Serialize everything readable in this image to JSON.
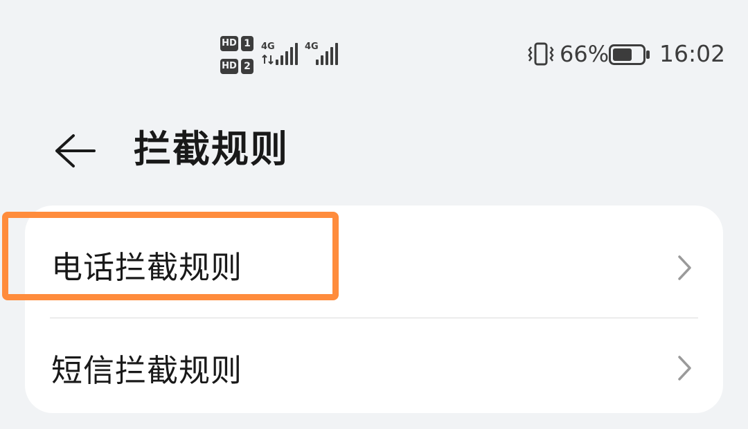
{
  "statusbar": {
    "sim1": {
      "hd": "HD",
      "slot": "1",
      "network": "4G"
    },
    "sim2": {
      "hd": "HD",
      "slot": "2",
      "network": "4G"
    },
    "vibrate_icon": "vibrate-icon",
    "battery_percent": "66%",
    "battery_level": 0.66,
    "time": "16:02"
  },
  "header": {
    "back_icon": "back-arrow-icon",
    "title": "拦截规则"
  },
  "list": {
    "items": [
      {
        "label": "电话拦截规则",
        "icon": "chevron-right-icon"
      },
      {
        "label": "短信拦截规则",
        "icon": "chevron-right-icon"
      }
    ]
  },
  "colors": {
    "background": "#f1f3f5",
    "card": "#ffffff",
    "highlight": "#ff8c3c",
    "text": "#191919"
  }
}
